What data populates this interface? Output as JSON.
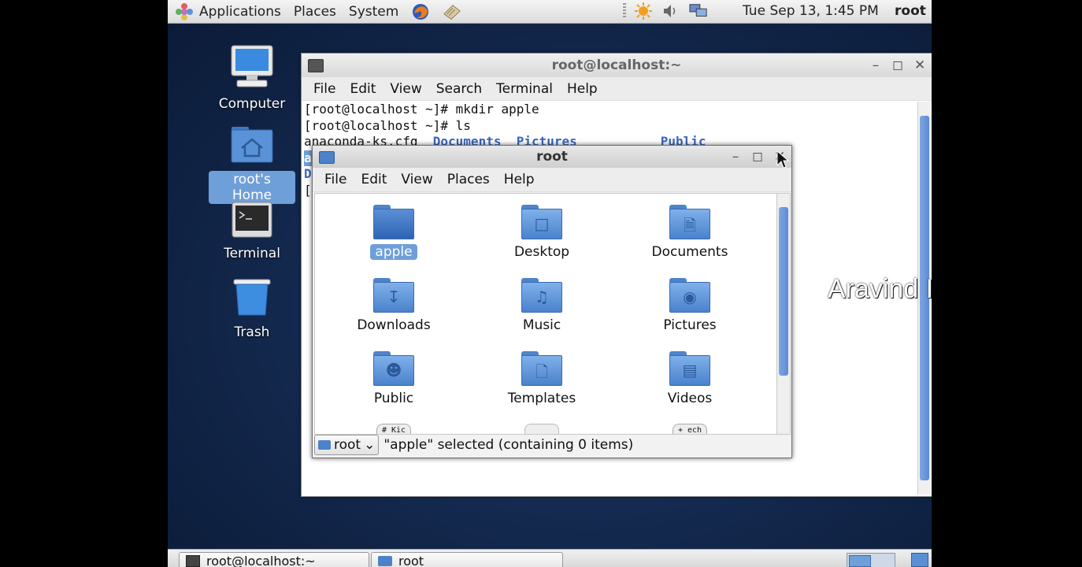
{
  "top_panel": {
    "applications": "Applications",
    "places": "Places",
    "system": "System",
    "clock": "Tue Sep 13,  1:45 PM",
    "user": "root"
  },
  "desktop": {
    "icons": [
      {
        "label": "Computer"
      },
      {
        "label": "root's Home"
      },
      {
        "label": "Terminal"
      },
      {
        "label": "Trash"
      }
    ]
  },
  "terminal": {
    "title": "root@localhost:~",
    "menu": [
      "File",
      "Edit",
      "View",
      "Search",
      "Terminal",
      "Help"
    ],
    "lines": [
      "[root@localhost ~]# mkdir apple",
      "[root@localhost ~]# ls"
    ],
    "ls_line": {
      "file": "anaconda-ks.cfg",
      "dirs": [
        "Documents",
        "Pictures",
        "Public"
      ]
    },
    "partial_chars": [
      "a",
      "D",
      "["
    ]
  },
  "file_manager": {
    "title": "root",
    "menu": [
      "File",
      "Edit",
      "View",
      "Places",
      "Help"
    ],
    "items": [
      {
        "label": "apple",
        "selected": true
      },
      {
        "label": "Desktop"
      },
      {
        "label": "Documents"
      },
      {
        "label": "Downloads"
      },
      {
        "label": "Music"
      },
      {
        "label": "Pictures"
      },
      {
        "label": "Public"
      },
      {
        "label": "Templates"
      },
      {
        "label": "Videos"
      }
    ],
    "partial_files": [
      "# Kic",
      "+ ech"
    ],
    "path_button": "root",
    "status": "\"apple\" selected (containing 0 items)"
  },
  "watermark": "Aravind I.T learning",
  "taskbar": {
    "tasks": [
      "root@localhost:~",
      "root"
    ]
  }
}
